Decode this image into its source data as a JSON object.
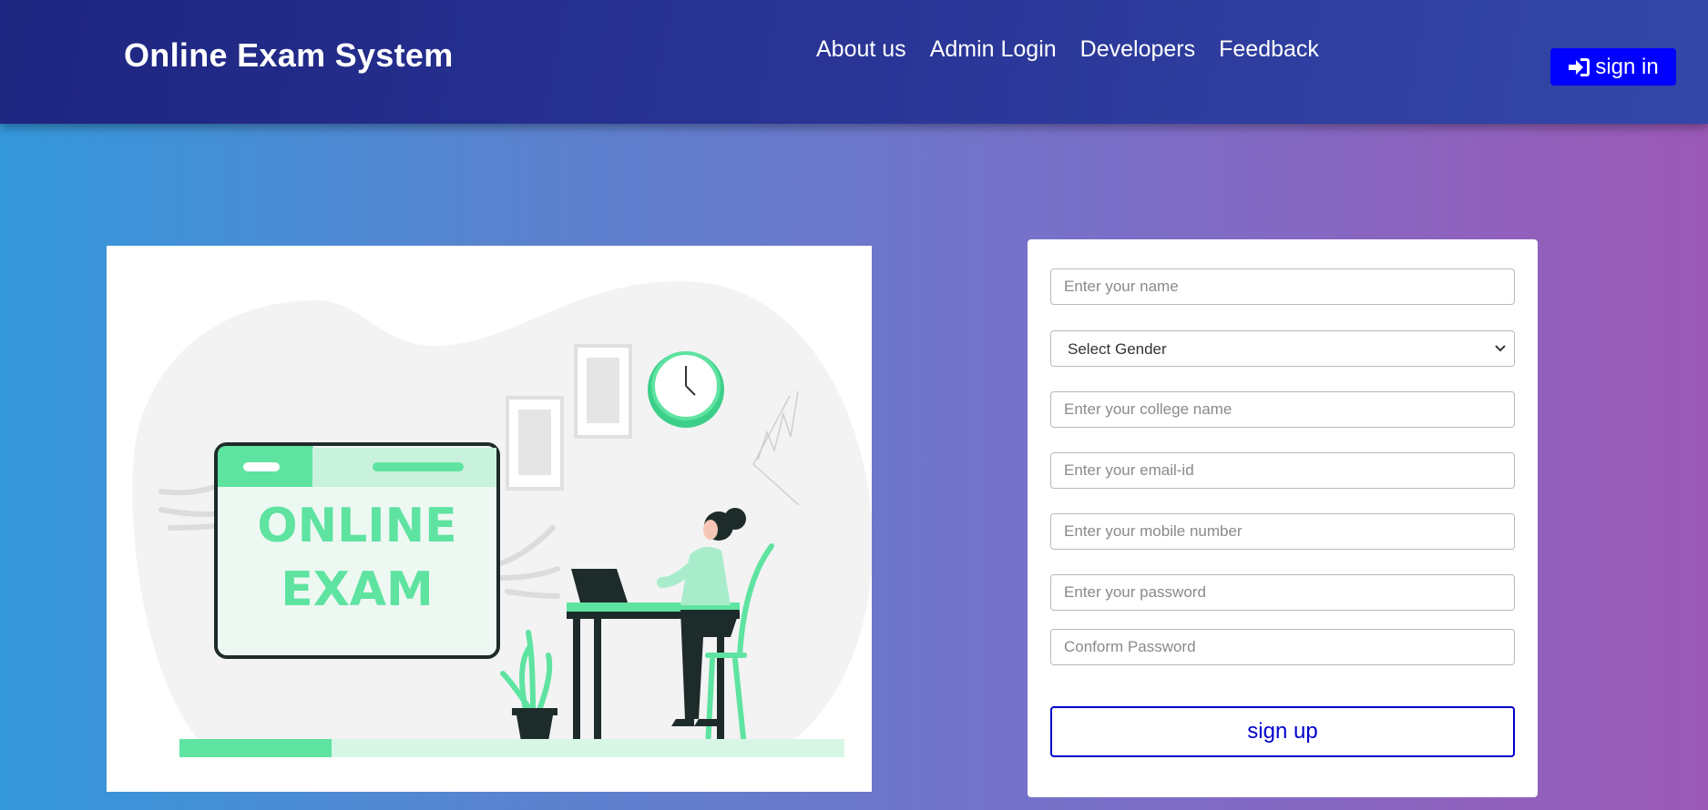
{
  "brand": "Online Exam System",
  "nav": {
    "links": [
      "About us",
      "Admin Login",
      "Developers",
      "Feedback"
    ],
    "signin_label": "sign in"
  },
  "hero": {
    "screen_text_line1": "ONLINE",
    "screen_text_line2": "EXAM"
  },
  "form": {
    "name_placeholder": "Enter your name",
    "gender_selected": "Select Gender",
    "college_placeholder": "Enter your college name",
    "email_placeholder": "Enter your email-id",
    "mobile_placeholder": "Enter your mobile number",
    "password_placeholder": "Enter your password",
    "confirm_placeholder": "Conform Password",
    "submit_label": "sign up"
  },
  "colors": {
    "accent_blue": "#0000ff",
    "navbar": "#2a3596",
    "illustration_green": "#5ee3a1"
  },
  "icons": [
    "sign-in-icon",
    "chevron-down-icon"
  ]
}
